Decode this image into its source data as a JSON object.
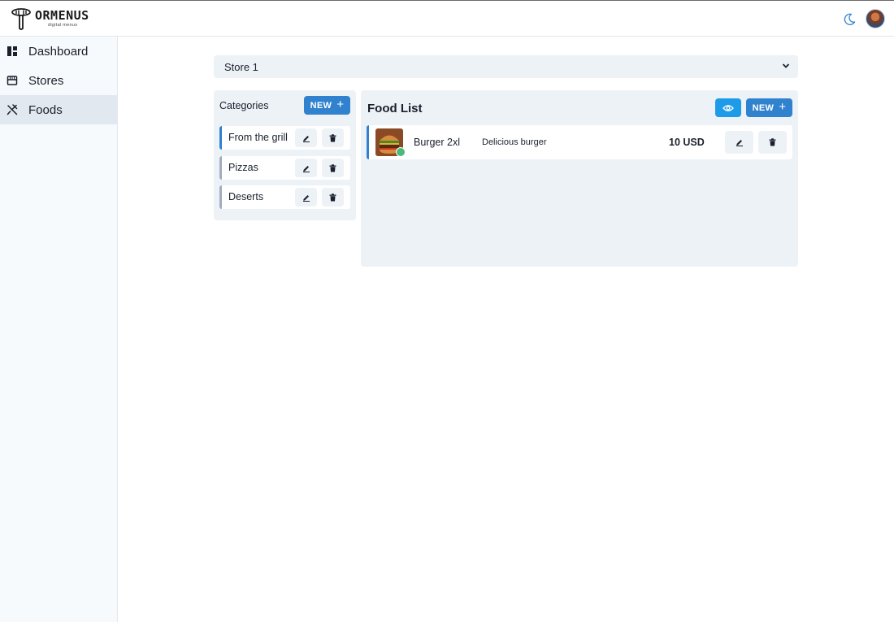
{
  "header": {
    "logo_text": "ORMENUS",
    "logo_subtext": "digital menus"
  },
  "sidebar": {
    "items": [
      {
        "label": "Dashboard",
        "icon": "dashboard-icon",
        "active": false
      },
      {
        "label": "Stores",
        "icon": "store-icon",
        "active": false
      },
      {
        "label": "Foods",
        "icon": "utensils-icon",
        "active": true
      }
    ]
  },
  "store_select": {
    "value": "Store 1"
  },
  "categories": {
    "title": "Categories",
    "new_label": "NEW",
    "items": [
      {
        "label": "From the grill",
        "active": true
      },
      {
        "label": "Pizzas",
        "active": false
      },
      {
        "label": "Deserts",
        "active": false
      }
    ]
  },
  "food_list": {
    "title": "Food List",
    "new_label": "NEW",
    "items": [
      {
        "name": "Burger 2xl",
        "description": "Delicious burger",
        "price": "10 USD",
        "status": "active"
      }
    ]
  },
  "colors": {
    "accent": "#3182ce",
    "preview_button": "#1e9be8",
    "panel_bg": "#edf2f7",
    "status_active": "#48bb78"
  }
}
